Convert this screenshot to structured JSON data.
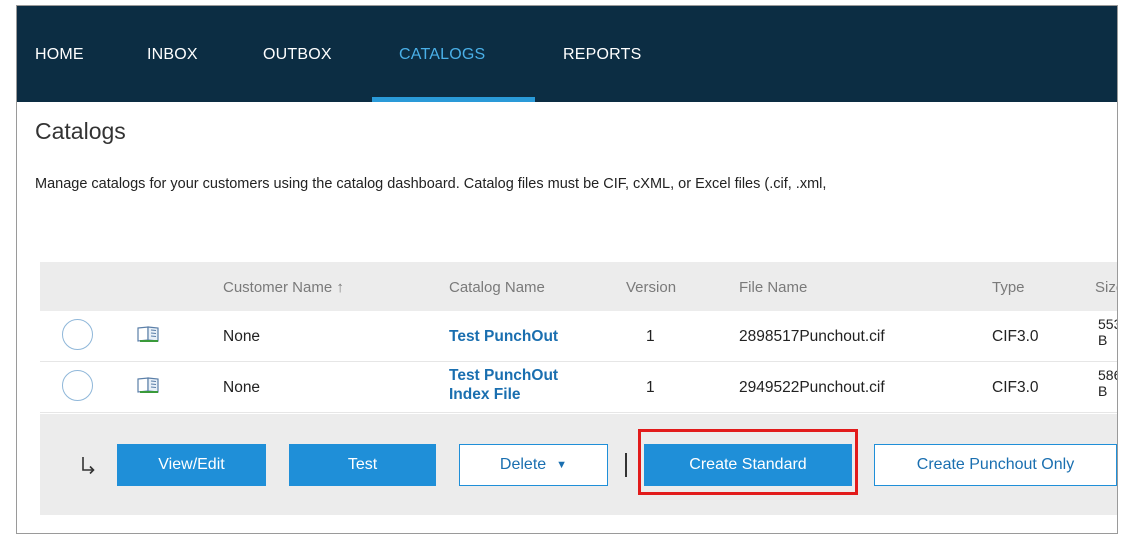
{
  "nav": {
    "items": [
      {
        "label": "HOME",
        "active": false
      },
      {
        "label": "INBOX",
        "active": false
      },
      {
        "label": "OUTBOX",
        "active": false
      },
      {
        "label": "CATALOGS",
        "active": true
      },
      {
        "label": "REPORTS",
        "active": false
      }
    ]
  },
  "page": {
    "title": "Catalogs",
    "description": "Manage catalogs for your customers using the catalog dashboard. Catalog files must be CIF, cXML, or Excel files (.cif, .xml,"
  },
  "table": {
    "columns": [
      "Customer Name ↑",
      "Catalog Name",
      "Version",
      "File Name",
      "Type",
      "Size"
    ],
    "rows": [
      {
        "customer": "None",
        "catalog_line1": "Test PunchOut",
        "catalog_line2": "",
        "version": "1",
        "file": "2898517Punchout.cif",
        "type": "CIF3.0",
        "size_line1": "553",
        "size_line2": "B"
      },
      {
        "customer": "None",
        "catalog_line1": "Test PunchOut",
        "catalog_line2": "Index File",
        "version": "1",
        "file": "2949522Punchout.cif",
        "type": "CIF3.0",
        "size_line1": "586",
        "size_line2": "B"
      }
    ]
  },
  "actions": {
    "view_edit": "View/Edit",
    "test": "Test",
    "delete": "Delete",
    "create_standard": "Create Standard",
    "create_punchout": "Create Punchout Only"
  },
  "colors": {
    "nav_bg": "#0c2d43",
    "accent": "#1f8fd8",
    "link": "#1a6fb0",
    "highlight": "#e21b1b"
  },
  "icons": {
    "row_icon": "catalog-book-icon",
    "bulk_arrow": "return-arrow-icon",
    "dropdown": "caret-down-icon"
  }
}
